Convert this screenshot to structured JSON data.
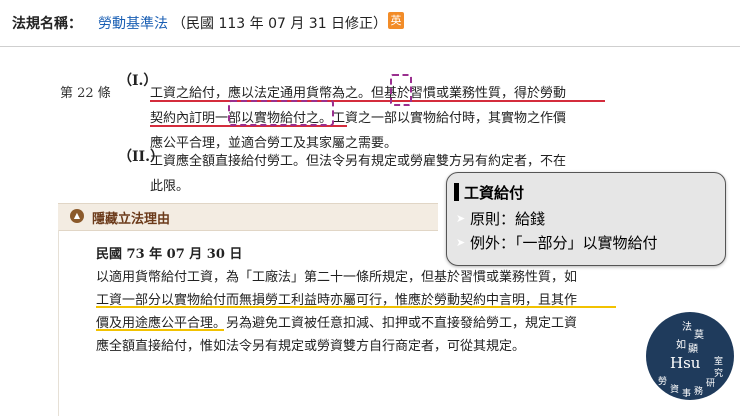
{
  "header": {
    "label": "法規名稱：",
    "law_name": "勞動基準法",
    "date_note": "（民國 113 年 07 月 31 日修正）",
    "en_badge": "英"
  },
  "article": {
    "number": "第 22 條",
    "para1_marker": "（I.）",
    "para1_lines": [
      "工資之給付，應以法定通用貨幣為之。但基於習慣或業務性質，得於勞動",
      "契約內訂明一部以實物給付之。工資之一部以實物給付時，其實物之作價",
      "應公平合理，並適合勞工及其家屬之需要。"
    ],
    "para2_marker": "（II.）",
    "para2_lines": [
      "工資應全額直接給付勞工。但法令另有規定或勞雇雙方另有約定者，不在",
      "此限。"
    ]
  },
  "reason": {
    "title": "隱藏立法理由",
    "date": "民國 73 年 07 月 30 日",
    "lines": [
      "以適用貨幣給付工資，為「工廠法」第二十一條所規定，但基於習慣或業務性質，如",
      "工資一部分以實物給付而無損勞工利益時亦屬可行，惟應於勞動契約中言明，且其作",
      "價及用途應公平合理。另為避免工資被任意扣減、扣押或不直接發給勞工，規定工資",
      "應全額直接給付，惟如法令另有規定或勞資雙方自行商定者，可從其規定。"
    ]
  },
  "callout": {
    "title": "工資給付",
    "bullet": "➤",
    "point1": "原則：給錢",
    "point2": "例外：「一部分」以實物給付"
  },
  "stamp": {
    "chars": [
      "法",
      "莫",
      "如",
      "顯",
      "Hsu",
      "勞",
      "資",
      "事",
      "務",
      "研",
      "究",
      "室"
    ]
  },
  "colors": {
    "accent_red": "#d42c3c",
    "accent_yellow": "#f2c200",
    "dash_purple": "#9a2f8f",
    "link_blue": "#1a5fb4"
  }
}
